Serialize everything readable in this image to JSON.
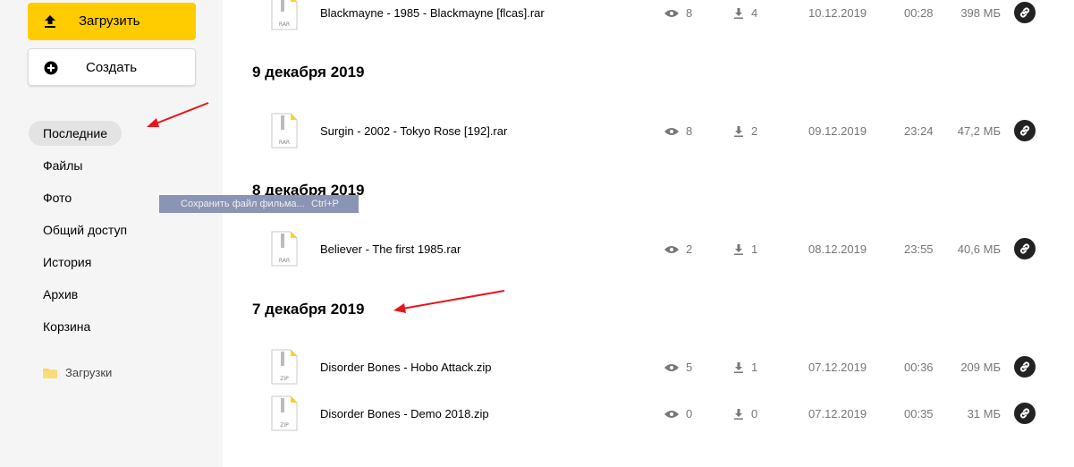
{
  "sidebar": {
    "upload_label": "Загрузить",
    "create_label": "Создать",
    "nav": [
      {
        "label": "Последние",
        "active": true
      },
      {
        "label": "Файлы"
      },
      {
        "label": "Фото"
      },
      {
        "label": "Общий доступ"
      },
      {
        "label": "История"
      },
      {
        "label": "Архив"
      },
      {
        "label": "Корзина"
      }
    ],
    "folder_label": "Загрузки"
  },
  "tooltip": {
    "label": "Сохранить файл фильма...",
    "shortcut": "Ctrl+P"
  },
  "groups": {
    "g1": "9 декабря 2019",
    "g2": "8 декабря 2019",
    "g3": "7 декабря 2019"
  },
  "files": [
    {
      "name": "Blackmayne - 1985 - Blackmayne [flcas].rar",
      "type": "RAR",
      "views": "8",
      "downloads": "4",
      "date": "10.12.2019",
      "time": "00:28",
      "size": "398 МБ"
    },
    {
      "name": "Surgin - 2002 - Tokyo Rose [192].rar",
      "type": "RAR",
      "views": "8",
      "downloads": "2",
      "date": "09.12.2019",
      "time": "23:24",
      "size": "47,2 МБ"
    },
    {
      "name": "Believer - The first 1985.rar",
      "type": "RAR",
      "views": "2",
      "downloads": "1",
      "date": "08.12.2019",
      "time": "23:55",
      "size": "40,6 МБ"
    },
    {
      "name": "Disorder Bones - Hobo Attack.zip",
      "type": "ZIP",
      "views": "5",
      "downloads": "1",
      "date": "07.12.2019",
      "time": "00:36",
      "size": "209 МБ"
    },
    {
      "name": "Disorder Bones - Demo 2018.zip",
      "type": "ZIP",
      "views": "0",
      "downloads": "0",
      "date": "07.12.2019",
      "time": "00:35",
      "size": "31 МБ"
    }
  ],
  "colors": {
    "accent_yellow": "#ffcc00",
    "annotation_red": "#e8141b",
    "sidebar_bg": "#f5f5f5"
  }
}
